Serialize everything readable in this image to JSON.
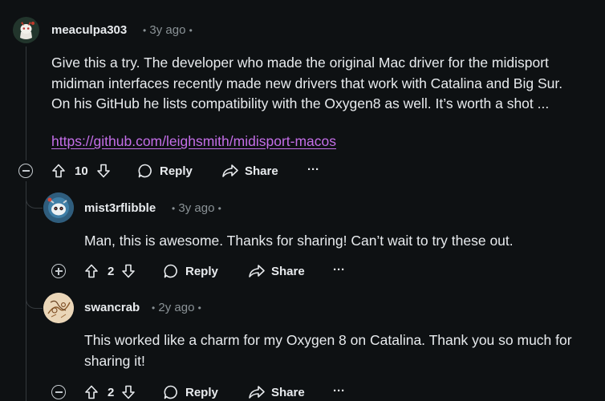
{
  "comments": [
    {
      "author": "meaculpa303",
      "time": "3y ago",
      "lines": [
        "Give this a try. The developer who made the original Mac driver for the midisport",
        "midiman interfaces recently made new drivers that work with Catalina and Big Sur.",
        "On his GitHub he lists compatibility with the Oxygen8 as well. It’s worth a shot ..."
      ],
      "link": "https://github.com/leighsmith/midisport-macos",
      "score": "10",
      "reply_label": "Reply",
      "share_label": "Share",
      "more_label": "···"
    },
    {
      "author": "mist3rflibble",
      "time": "3y ago",
      "lines": [
        "Man, this is awesome. Thanks for sharing! Can’t wait to try these out."
      ],
      "score": "2",
      "reply_label": "Reply",
      "share_label": "Share",
      "more_label": "···"
    },
    {
      "author": "swancrab",
      "time": "2y ago",
      "lines": [
        "This worked like a charm for my Oxygen 8 on Catalina. Thank you so much for",
        "sharing it!"
      ],
      "score": "2",
      "reply_label": "Reply",
      "share_label": "Share",
      "more_label": "···"
    }
  ],
  "separator": "•",
  "colors": {
    "background": "#0e1113",
    "link": "#c46ee8",
    "muted": "#8a9296"
  }
}
